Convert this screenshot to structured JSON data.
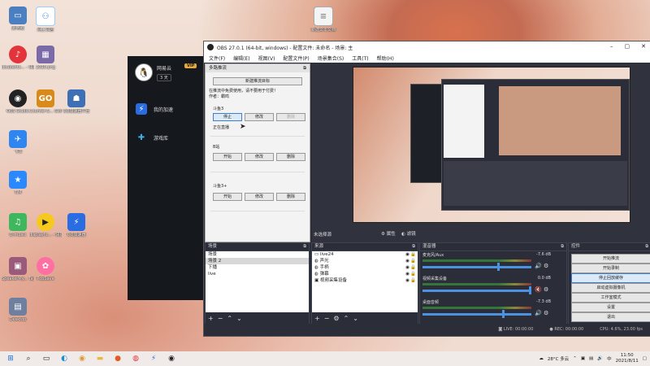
{
  "desktop_icons": [
    {
      "label": "此电脑",
      "icon": "computer-icon",
      "color": "#4a7fc1"
    },
    {
      "label": "网上邻居",
      "icon": "network-icon",
      "color": "#3a82e0"
    },
    {
      "label": "doubantx... - 快捷方式",
      "icon": "netease-music-icon",
      "color": "#e3333b"
    },
    {
      "label": "2020.png",
      "icon": "image-icon",
      "color": "#7a6aa8"
    },
    {
      "label": "OBS Studio",
      "icon": "obs-icon",
      "color": "#222"
    },
    {
      "label": "Counter-S... Global Off...",
      "icon": "csgo-icon",
      "color": "#d88a1a"
    },
    {
      "label": "QQ加速器平台",
      "icon": "game-icon",
      "color": "#3f6fb5"
    },
    {
      "label": "飞书",
      "icon": "feishu-icon",
      "color": "#2f86f0"
    },
    {
      "label": "TIM",
      "icon": "tim-icon",
      "color": "#2b89ff"
    },
    {
      "label": "Q-music",
      "icon": "music-icon",
      "color": "#3fb75e"
    },
    {
      "label": "displayfu... - 快捷方式",
      "icon": "display-icon",
      "color": "#222"
    },
    {
      "label": "QQ加速器",
      "icon": "speed-icon",
      "color": "#2a6de3"
    },
    {
      "label": "SpeakerMy... Taylor Swi...",
      "icon": "photo-icon",
      "color": "#9a5a7a"
    },
    {
      "label": "PopSave",
      "icon": "pop-icon",
      "color": "#ff6fa1"
    },
    {
      "label": "Desktop",
      "icon": "folder-image-icon",
      "color": "#6f7fa0"
    },
    {
      "label": "新建文本文档",
      "icon": "text-file-icon",
      "color": "#f4f4f4"
    }
  ],
  "qq_panel": {
    "username": "网易云",
    "vip": "VIP",
    "days": "3 天",
    "nav": [
      {
        "label": "我的加速",
        "icon": "lightning-icon"
      },
      {
        "label": "游戏库",
        "icon": "gamepad-icon"
      }
    ]
  },
  "obs": {
    "title": "OBS 27.0.1 (64-bit, windows) - 配置文件: 未命名 - 场景: 主",
    "menu": [
      "文件(F)",
      "编辑(E)",
      "视图(V)",
      "配置文件(P)",
      "场景集合(S)",
      "工具(T)",
      "帮助(H)"
    ],
    "multistream": {
      "title": "多路推流",
      "new_button": "新建推流目标",
      "note1": "在推流中免费使用，请不要用于付费！",
      "note2": "作者：霸鸣",
      "targets": [
        {
          "name": "斗鱼3",
          "start": "停止",
          "edit": "修改",
          "delete": "删除",
          "status": "正在直播"
        },
        {
          "name": "B站",
          "start": "开始",
          "edit": "修改",
          "delete": "删除",
          "status": ""
        },
        {
          "name": "斗鱼3+",
          "start": "开始",
          "edit": "修改",
          "delete": "删除",
          "status": ""
        }
      ]
    },
    "preview_label": "未选择源",
    "properties_tab": "属性",
    "filters_tab": "滤镜",
    "scenes": {
      "title": "场景",
      "items": [
        "场景",
        "场景 2",
        "下播",
        "live"
      ]
    },
    "sources": {
      "title": "来源",
      "items": [
        "live24",
        "声光",
        "手柄",
        "弹幕",
        "视频采集设备"
      ]
    },
    "mixer": {
      "title": "混音器",
      "channels": [
        {
          "name": "麦克风/Aux",
          "db": "-7.6 dB",
          "level": 0.7
        },
        {
          "name": "视频采集设备",
          "db": "0.0 dB",
          "level": 1.0
        },
        {
          "name": "桌面音频",
          "db": "-7.3 dB",
          "level": 0.75
        }
      ]
    },
    "controls": {
      "title": "控件",
      "buttons": [
        "开始推流",
        "开始录制",
        "停止回放缓存",
        "启动虚拟摄像机",
        "工作室模式",
        "设置",
        "退出"
      ]
    },
    "status": {
      "live": "LIVE: 00:00:00",
      "rec": "REC: 00:00:00",
      "cpu": "CPU: 4.6%, 23.00 fps"
    }
  },
  "taskbar": {
    "weather": "28°C 多云",
    "ime": "中",
    "time": "11:50",
    "date": "2021/8/11"
  }
}
